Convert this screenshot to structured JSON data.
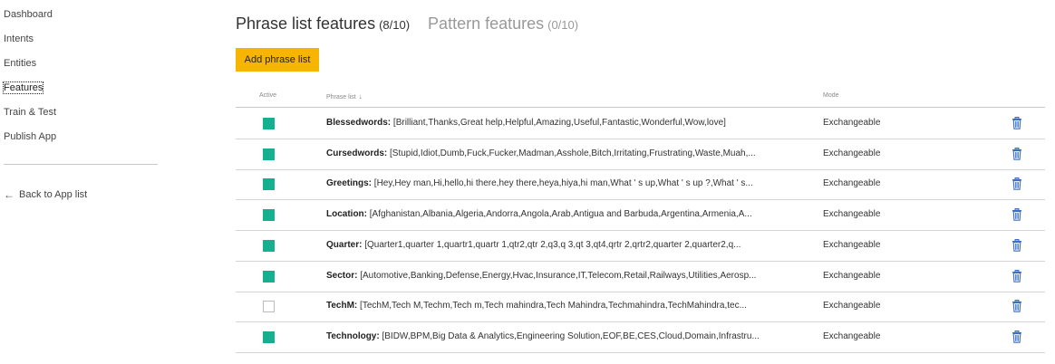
{
  "sidebar": {
    "items": [
      {
        "label": "Dashboard"
      },
      {
        "label": "Intents"
      },
      {
        "label": "Entities"
      },
      {
        "label": "Features"
      },
      {
        "label": "Train & Test"
      },
      {
        "label": "Publish App"
      }
    ],
    "active_item": "Features",
    "back_label": "Back to App list"
  },
  "header": {
    "tabs": [
      {
        "title": "Phrase list features",
        "count": "(8/10)"
      },
      {
        "title": "Pattern features",
        "count": "(0/10)"
      }
    ]
  },
  "add_button_label": "Add phrase list",
  "table": {
    "columns": {
      "active": "Active",
      "phrase": "Phrase list",
      "mode": "Mode"
    },
    "rows": [
      {
        "name": "Blessedwords:",
        "values": "[Brilliant,Thanks,Great help,Helpful,Amazing,Useful,Fantastic,Wonderful,Wow,love]",
        "mode": "Exchangeable",
        "active": true
      },
      {
        "name": "Cursedwords:",
        "values": "[Stupid,Idiot,Dumb,Fuck,Fucker,Madman,Asshole,Bitch,Irritating,Frustrating,Waste,Muah,...",
        "mode": "Exchangeable",
        "active": true
      },
      {
        "name": "Greetings:",
        "values": "[Hey,Hey man,Hi,hello,hi there,hey there,heya,hiya,hi man,What ' s up,What ' s up ?,What ' s...",
        "mode": "Exchangeable",
        "active": true
      },
      {
        "name": "Location:",
        "values": "[Afghanistan,Albania,Algeria,Andorra,Angola,Arab,Antigua and Barbuda,Argentina,Armenia,A...",
        "mode": "Exchangeable",
        "active": true
      },
      {
        "name": "Quarter:",
        "values": "[Quarter1,quarter 1,quartr1,quartr 1,qtr2,qtr 2,q3,q 3,qt 3,qt4,qrtr 2,qrtr2,quarter 2,quarter2,q...",
        "mode": "Exchangeable",
        "active": true
      },
      {
        "name": "Sector:",
        "values": "[Automotive,Banking,Defense,Energy,Hvac,Insurance,IT,Telecom,Retail,Railways,Utilities,Aerosp...",
        "mode": "Exchangeable",
        "active": true
      },
      {
        "name": "TechM:",
        "values": "[TechM,Tech M,Techm,Tech m,Tech mahindra,Tech Mahindra,Techmahindra,TechMahindra,tec...",
        "mode": "Exchangeable",
        "active": false
      },
      {
        "name": "Technology:",
        "values": "[BIDW,BPM,Big Data & Analytics,Engineering Solution,EOF,BE,CES,Cloud,Domain,Infrastru...",
        "mode": "Exchangeable",
        "active": true
      }
    ]
  },
  "colors": {
    "accent": "#f7b400",
    "active_checkbox": "#15b08f",
    "delete_icon": "#3b6fc4"
  }
}
